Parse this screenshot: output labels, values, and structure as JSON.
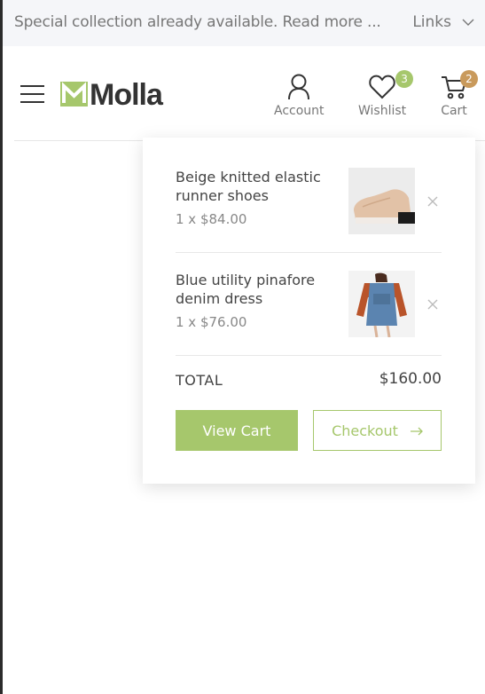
{
  "topbar": {
    "announcement": "Special collection already available. Read more ...",
    "links_label": "Links",
    "links_icon": "chevron-down-icon"
  },
  "header": {
    "logo_text": "Molla",
    "menu_icon": "hamburger-icon",
    "account_label": "Account",
    "wishlist_label": "Wishlist",
    "wishlist_count": "3",
    "cart_label": "Cart",
    "cart_count": "2"
  },
  "cart_dropdown": {
    "items": [
      {
        "name": "Beige knitted elastic runner shoes",
        "quantity_price": "1 x $84.00",
        "image": "beige-shoe-image"
      },
      {
        "name": "Blue utility pinafore denim dress",
        "quantity_price": "1 x $76.00",
        "image": "denim-dress-image"
      }
    ],
    "total_label": "TOTAL",
    "total_value": "$160.00",
    "view_cart_label": "View Cart",
    "checkout_label": "Checkout"
  },
  "colors": {
    "accent": "#a6c76c",
    "cart_badge": "#c99a5c",
    "topbar_bg": "#f5f6f9"
  }
}
